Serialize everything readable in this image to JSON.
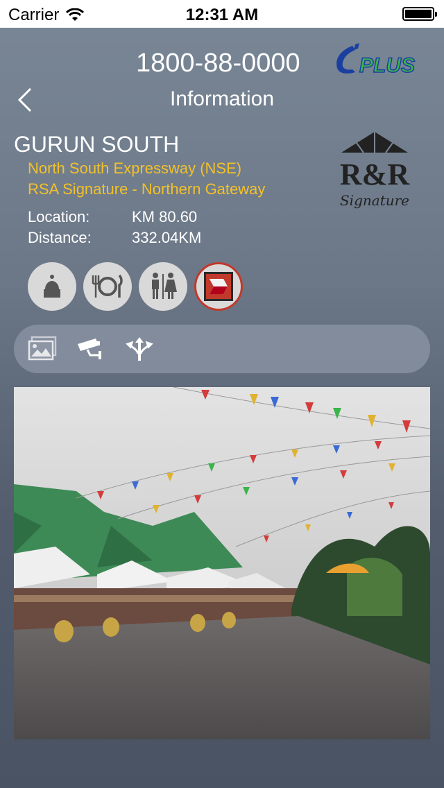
{
  "status": {
    "carrier": "Carrier",
    "time": "12:31 AM"
  },
  "header": {
    "phone": "1800-88-0000",
    "title": "Information",
    "logo_text": "PLUS"
  },
  "station": {
    "name": "GURUN SOUTH",
    "highway": "North South Expressway (NSE)",
    "operator": "RSA Signature - Northern Gateway",
    "location_label": "Location:",
    "location_value": "KM 80.60",
    "distance_label": "Distance:",
    "distance_value": "332.04KM",
    "badge_text": "R&R",
    "badge_sub": "Signature"
  },
  "amenities": [
    "mosque-icon",
    "restaurant-icon",
    "restroom-icon",
    "petrol-station-icon"
  ],
  "toolbar": [
    "gallery-icon",
    "cctv-icon",
    "directions-icon"
  ],
  "colors": {
    "accent": "#f2c12a",
    "logo_blue": "#1a3fa0",
    "logo_green": "#3bb54a",
    "badge_red": "#c0392b"
  }
}
